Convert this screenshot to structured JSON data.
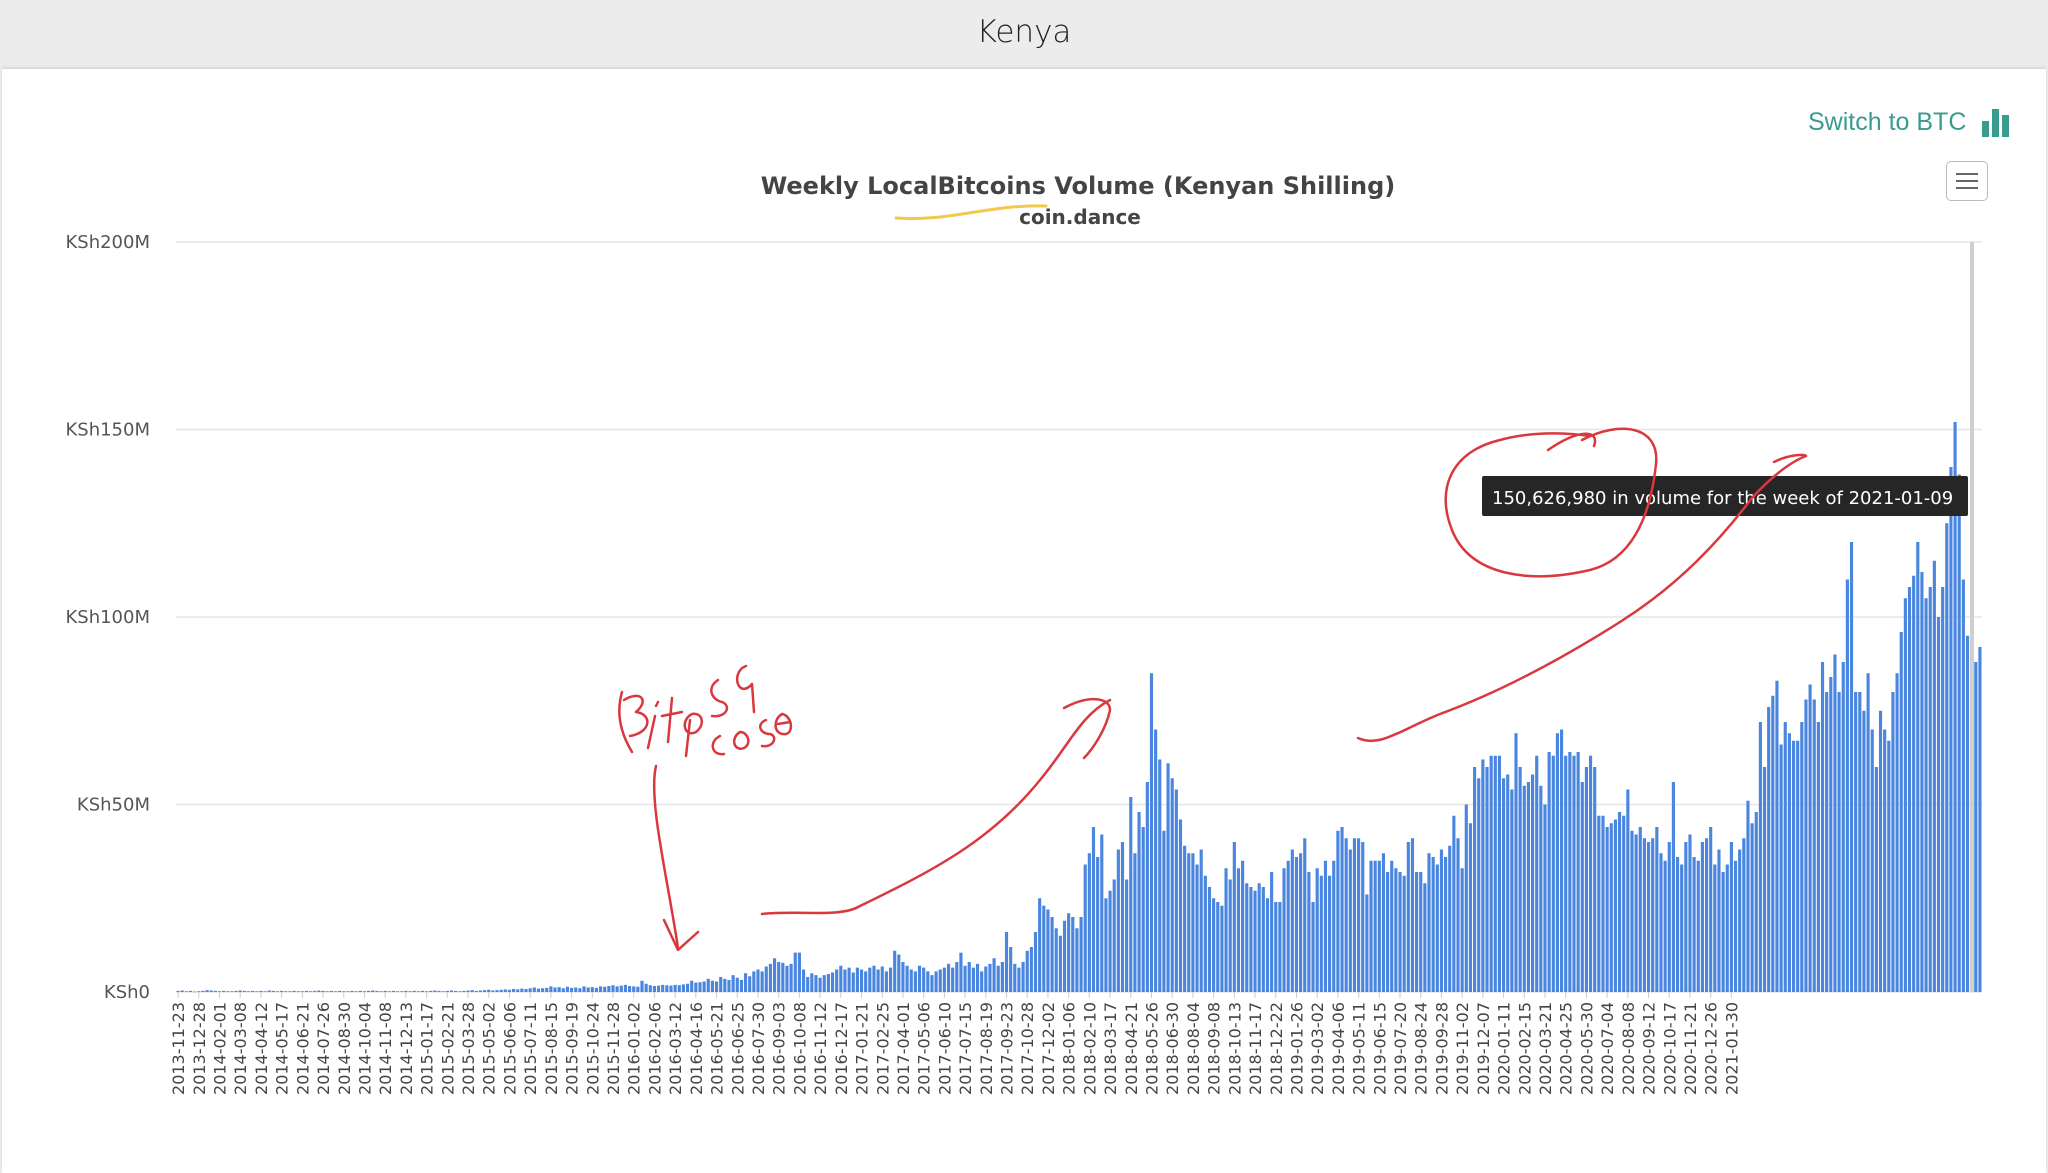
{
  "page": {
    "title": "Kenya"
  },
  "toolbar": {
    "switch_label": "Switch to BTC",
    "switch_icon": "bar-chart-icon",
    "menu_icon": "hamburger-menu-icon",
    "accent": "#3a9b8f"
  },
  "tooltip": {
    "text": "150,626,980 in volume for the week of 2021-01-09"
  },
  "annotations": {
    "ink_color": "#d9383f",
    "highlight_color": "#f2c94c",
    "handwritten_note": "Bitpesa case"
  },
  "chart_data": {
    "type": "bar",
    "title": "Weekly LocalBitcoins Volume (Kenyan Shilling)",
    "subtitle": "coin.dance",
    "bar_color": "#4a86e0",
    "ylim": [
      0,
      200000000
    ],
    "y_ticks": [
      {
        "value": 0,
        "label": "KSh0"
      },
      {
        "value": 50000000,
        "label": "KSh50M"
      },
      {
        "value": 100000000,
        "label": "KSh100M"
      },
      {
        "value": 150000000,
        "label": "KSh150M"
      },
      {
        "value": 200000000,
        "label": "KSh200M"
      }
    ],
    "x_tick_labels": [
      "2013-11-23",
      "2013-12-28",
      "2014-02-01",
      "2014-03-08",
      "2014-04-12",
      "2014-05-17",
      "2014-06-21",
      "2014-07-26",
      "2014-08-30",
      "2014-10-04",
      "2014-11-08",
      "2014-12-13",
      "2015-01-17",
      "2015-02-21",
      "2015-03-28",
      "2015-05-02",
      "2015-06-06",
      "2015-07-11",
      "2015-08-15",
      "2015-09-19",
      "2015-10-24",
      "2015-11-28",
      "2016-01-02",
      "2016-02-06",
      "2016-03-12",
      "2016-04-16",
      "2016-05-21",
      "2016-06-25",
      "2016-07-30",
      "2016-09-03",
      "2016-10-08",
      "2016-11-12",
      "2016-12-17",
      "2017-01-21",
      "2017-02-25",
      "2017-04-01",
      "2017-05-06",
      "2017-06-10",
      "2017-07-15",
      "2017-08-19",
      "2017-09-23",
      "2017-10-28",
      "2017-12-02",
      "2018-01-06",
      "2018-02-10",
      "2018-03-17",
      "2018-04-21",
      "2018-05-26",
      "2018-06-30",
      "2018-08-04",
      "2018-09-08",
      "2018-10-13",
      "2018-11-17",
      "2018-12-22",
      "2019-01-26",
      "2019-03-02",
      "2019-04-06",
      "2019-05-11",
      "2019-06-15",
      "2019-07-20",
      "2019-08-24",
      "2019-09-28",
      "2019-11-02",
      "2019-12-07",
      "2020-01-11",
      "2020-02-15",
      "2020-03-21",
      "2020-04-25",
      "2020-05-30",
      "2020-07-04",
      "2020-08-08",
      "2020-09-12",
      "2020-10-17",
      "2020-11-21",
      "2020-12-26",
      "2021-01-30"
    ],
    "bars_per_tick": 5,
    "values_m": [
      0.3,
      0.4,
      0.2,
      0.3,
      0.1,
      0.2,
      0.3,
      0.5,
      0.4,
      0.3,
      0.2,
      0.3,
      0.2,
      0.2,
      0.3,
      0.4,
      0.3,
      0.2,
      0.3,
      0.2,
      0.3,
      0.2,
      0.4,
      0.3,
      0.2,
      0.3,
      0.2,
      0.2,
      0.3,
      0.2,
      0.2,
      0.3,
      0.2,
      0.3,
      0.4,
      0.3,
      0.2,
      0.3,
      0.2,
      0.3,
      0.2,
      0.2,
      0.3,
      0.2,
      0.3,
      0.2,
      0.3,
      0.4,
      0.3,
      0.2,
      0.3,
      0.2,
      0.3,
      0.2,
      0.2,
      0.3,
      0.2,
      0.3,
      0.2,
      0.3,
      0.2,
      0.3,
      0.4,
      0.3,
      0.2,
      0.3,
      0.4,
      0.3,
      0.2,
      0.3,
      0.4,
      0.5,
      0.3,
      0.4,
      0.5,
      0.6,
      0.4,
      0.5,
      0.6,
      0.7,
      0.6,
      0.8,
      0.7,
      0.9,
      0.8,
      1,
      1.2,
      0.9,
      1,
      1.1,
      1.5,
      1.2,
      1.3,
      1,
      1.4,
      1.1,
      1.2,
      1,
      1.5,
      1.2,
      1.3,
      1.1,
      1.5,
      1.4,
      1.6,
      1.8,
      1.5,
      1.7,
      1.9,
      1.6,
      1.5,
      1.4,
      3,
      2.2,
      1.8,
      1.6,
      1.7,
      1.9,
      1.8,
      1.7,
      1.9,
      1.8,
      2,
      2.2,
      3,
      2.5,
      2.6,
      2.8,
      3.5,
      3,
      2.8,
      4,
      3.5,
      3.2,
      4.5,
      3.8,
      3.2,
      5,
      4.2,
      5.5,
      6,
      5.5,
      6.8,
      7.5,
      9,
      8,
      7.8,
      7,
      7.5,
      10.5,
      10.5,
      6,
      4,
      5,
      4.5,
      3.8,
      4.5,
      4.8,
      5.2,
      6,
      7,
      6,
      6.5,
      5.2,
      6.5,
      6,
      5.5,
      6.5,
      7,
      6,
      6.8,
      5.5,
      6.5,
      11,
      10,
      8,
      7,
      6,
      5.5,
      7,
      6.5,
      5.5,
      4.5,
      5.5,
      6,
      6.5,
      7.5,
      6.5,
      8,
      10.5,
      7,
      8,
      6.5,
      7.5,
      5.5,
      6.8,
      7.5,
      9,
      7,
      8,
      16,
      12,
      7.5,
      6.5,
      8,
      11,
      12,
      16,
      25,
      23,
      22,
      20,
      17,
      15,
      19,
      21,
      20,
      17,
      20,
      34,
      37,
      44,
      36,
      42,
      25,
      27,
      30,
      38,
      40,
      30,
      52,
      37,
      48,
      44,
      56,
      85,
      70,
      62,
      43,
      61,
      57,
      54,
      46,
      39,
      37,
      37,
      34,
      38,
      31,
      28,
      25,
      24,
      23,
      33,
      30,
      40,
      33,
      35,
      29,
      28,
      27,
      29,
      28,
      25,
      32,
      24,
      24,
      33,
      35,
      38,
      36,
      37,
      41,
      32,
      24,
      33,
      31,
      35,
      31,
      35,
      43,
      44,
      41,
      38,
      41,
      41,
      40,
      26,
      35,
      35,
      35,
      37,
      32,
      35,
      33,
      32,
      31,
      40,
      41,
      32,
      32,
      29,
      37,
      36,
      34,
      38,
      36,
      39,
      47,
      41,
      33,
      50,
      45,
      60,
      57,
      62,
      60,
      63,
      63,
      63,
      57,
      58,
      54,
      69,
      60,
      55,
      56,
      58,
      63,
      55,
      50,
      64,
      63,
      69,
      70,
      63,
      64,
      63,
      64,
      56,
      60,
      63,
      60,
      47,
      47,
      44,
      45,
      46,
      48,
      47,
      54,
      43,
      42,
      44,
      41,
      40,
      41,
      44,
      37,
      35,
      40,
      56,
      36,
      34,
      40,
      42,
      36,
      35,
      40,
      41,
      44,
      34,
      38,
      32,
      34,
      40,
      35,
      38,
      41,
      51,
      45,
      48,
      72,
      60,
      76,
      79,
      83,
      66,
      72,
      69,
      67,
      67,
      72,
      78,
      82,
      78,
      72,
      88,
      80,
      84,
      90,
      80,
      88,
      110,
      120,
      80,
      80,
      75,
      85,
      70,
      60,
      75,
      70,
      67,
      80,
      85,
      96,
      105,
      108,
      111,
      120,
      112,
      105,
      108,
      115,
      100,
      108,
      125,
      140,
      152,
      138,
      110,
      95,
      92,
      88,
      92
    ]
  }
}
